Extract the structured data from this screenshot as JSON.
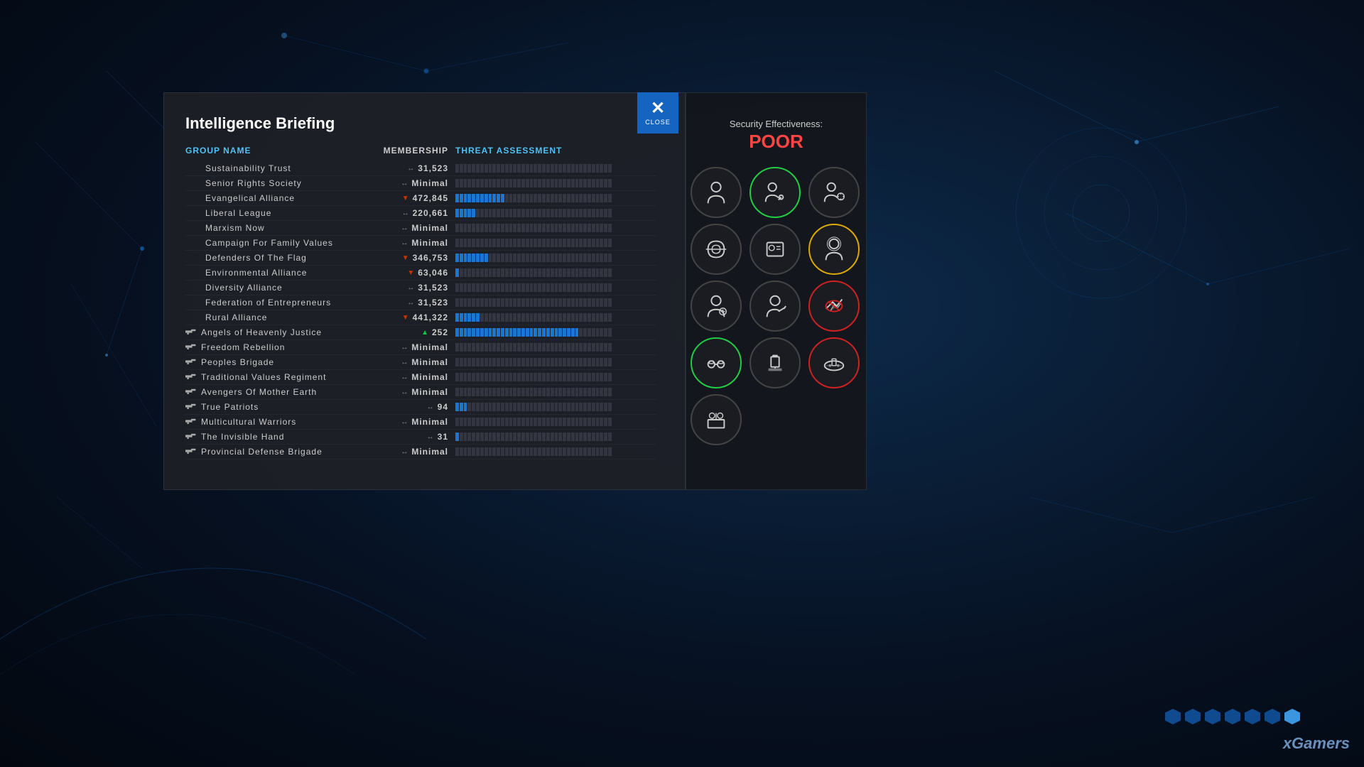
{
  "background": {
    "color": "#0a1a2e"
  },
  "briefing": {
    "title": "Intelligence Briefing",
    "columns": {
      "group_name": "GROUP NAME",
      "membership": "MEMBERSHIP",
      "threat_assessment": "THREAT ASSESSMENT"
    },
    "groups": [
      {
        "name": "Sustainability Trust",
        "membership": "31,523",
        "trend": "neutral",
        "is_militant": false,
        "threat_level": 0
      },
      {
        "name": "Senior Rights Society",
        "membership": "Minimal",
        "trend": "neutral",
        "is_militant": false,
        "threat_level": 0
      },
      {
        "name": "Evangelical Alliance",
        "membership": "472,845",
        "trend": "down",
        "is_militant": false,
        "threat_level": 12
      },
      {
        "name": "Liberal League",
        "membership": "220,661",
        "trend": "neutral",
        "is_militant": false,
        "threat_level": 5
      },
      {
        "name": "Marxism Now",
        "membership": "Minimal",
        "trend": "neutral",
        "is_militant": false,
        "threat_level": 0
      },
      {
        "name": "Campaign For Family Values",
        "membership": "Minimal",
        "trend": "neutral",
        "is_militant": false,
        "threat_level": 0
      },
      {
        "name": "Defenders Of The Flag",
        "membership": "346,753",
        "trend": "down",
        "is_militant": false,
        "threat_level": 8
      },
      {
        "name": "Environmental Alliance",
        "membership": "63,046",
        "trend": "down",
        "is_militant": false,
        "threat_level": 1
      },
      {
        "name": "Diversity Alliance",
        "membership": "31,523",
        "trend": "neutral",
        "is_militant": false,
        "threat_level": 0
      },
      {
        "name": "Federation of Entrepreneurs",
        "membership": "31,523",
        "trend": "neutral",
        "is_militant": false,
        "threat_level": 0
      },
      {
        "name": "Rural Alliance",
        "membership": "441,322",
        "trend": "down",
        "is_militant": false,
        "threat_level": 6
      },
      {
        "name": "Angels of Heavenly Justice",
        "membership": "252",
        "trend": "up",
        "is_militant": true,
        "threat_level": 30
      },
      {
        "name": "Freedom Rebellion",
        "membership": "Minimal",
        "trend": "neutral",
        "is_militant": true,
        "threat_level": 0
      },
      {
        "name": "Peoples Brigade",
        "membership": "Minimal",
        "trend": "neutral",
        "is_militant": true,
        "threat_level": 0
      },
      {
        "name": "Traditional Values Regiment",
        "membership": "Minimal",
        "trend": "neutral",
        "is_militant": true,
        "threat_level": 0
      },
      {
        "name": "Avengers Of Mother Earth",
        "membership": "Minimal",
        "trend": "neutral",
        "is_militant": true,
        "threat_level": 0
      },
      {
        "name": "True Patriots",
        "membership": "94",
        "trend": "neutral",
        "is_militant": true,
        "threat_level": 3
      },
      {
        "name": "Multicultural Warriors",
        "membership": "Minimal",
        "trend": "neutral",
        "is_militant": true,
        "threat_level": 0
      },
      {
        "name": "The Invisible Hand",
        "membership": "31",
        "trend": "neutral",
        "is_militant": true,
        "threat_level": 1
      },
      {
        "name": "Provincial Defense Brigade",
        "membership": "Minimal",
        "trend": "neutral",
        "is_militant": true,
        "threat_level": 0
      }
    ]
  },
  "security": {
    "label": "Security Effectiveness:",
    "status": "POOR",
    "status_color": "#ff4444",
    "buttons": [
      {
        "id": "btn1",
        "border": "none",
        "icon": "person"
      },
      {
        "id": "btn2",
        "border": "green",
        "icon": "person-target"
      },
      {
        "id": "btn3",
        "border": "none",
        "icon": "person-clock"
      },
      {
        "id": "btn4",
        "border": "none",
        "icon": "infinity"
      },
      {
        "id": "btn5",
        "border": "none",
        "icon": "id-card"
      },
      {
        "id": "btn6",
        "border": "yellow",
        "icon": "person-circle"
      },
      {
        "id": "btn7",
        "border": "none",
        "icon": "person-gear"
      },
      {
        "id": "btn8",
        "border": "none",
        "icon": "pen-tool"
      },
      {
        "id": "btn9",
        "border": "red",
        "icon": "plane-ban"
      },
      {
        "id": "btn10",
        "border": "green",
        "icon": "handcuffs"
      },
      {
        "id": "btn11",
        "border": "none",
        "icon": "judge"
      },
      {
        "id": "btn12",
        "border": "red",
        "icon": "submarine"
      },
      {
        "id": "btn13",
        "border": "none",
        "icon": "people-table"
      }
    ]
  },
  "close_button": {
    "label": "CLOSE"
  },
  "watermark": {
    "text": "xGamers"
  }
}
